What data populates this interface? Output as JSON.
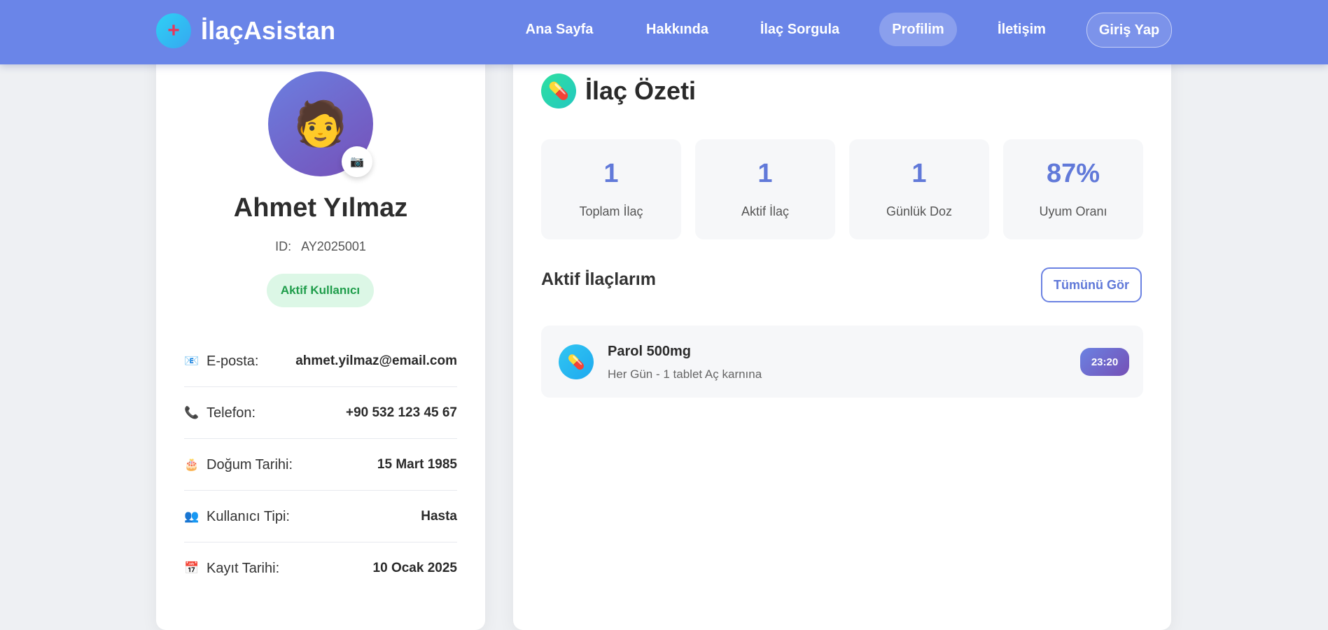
{
  "brand": {
    "name": "İlaçAsistan",
    "logo_symbol": "+",
    "icon": "plus-icon"
  },
  "nav": {
    "items": [
      {
        "label": "Ana Sayfa",
        "active": false
      },
      {
        "label": "Hakkında",
        "active": false
      },
      {
        "label": "İlaç Sorgula",
        "active": false
      },
      {
        "label": "Profilim",
        "active": true
      },
      {
        "label": "İletişim",
        "active": false
      }
    ],
    "login_label": "Giriş Yap"
  },
  "profile": {
    "avatar_icon": "🧑",
    "camera_icon": "📷",
    "name": "Ahmet Yılmaz",
    "id_label": "ID:",
    "id_value": "AY2025001",
    "status": "Aktif Kullanıcı",
    "info": [
      {
        "icon": "📧",
        "icon_name": "email-icon",
        "label": "E-posta:",
        "value": "ahmet.yilmaz@email.com"
      },
      {
        "icon": "📞",
        "icon_name": "phone-icon",
        "label": "Telefon:",
        "value": "+90 532 123 45 67"
      },
      {
        "icon": "🎂",
        "icon_name": "cake-icon",
        "label": "Doğum Tarihi:",
        "value": "15 Mart 1985"
      },
      {
        "icon": "👥",
        "icon_name": "users-icon",
        "label": "Kullanıcı Tipi:",
        "value": "Hasta"
      },
      {
        "icon": "📅",
        "icon_name": "calendar-icon",
        "label": "Kayıt Tarihi:",
        "value": "10 Ocak 2025"
      }
    ]
  },
  "summary": {
    "icon": "💊",
    "title": "İlaç Özeti",
    "stats": [
      {
        "value": "1",
        "label": "Toplam İlaç"
      },
      {
        "value": "1",
        "label": "Aktif İlaç"
      },
      {
        "value": "1",
        "label": "Günlük Doz"
      },
      {
        "value": "87%",
        "label": "Uyum Oranı"
      }
    ],
    "active_meds_title": "Aktif İlaçlarım",
    "see_all_label": "Tümünü Gör",
    "meds": [
      {
        "icon": "💊",
        "name": "Parol 500mg",
        "frequency": "Her Gün",
        "dose": "1 tablet",
        "note": "Aç karnına",
        "time": "23:20"
      }
    ]
  },
  "colors": {
    "navbar": "#6a85e8",
    "accent": "#6179d9",
    "status_green": "#1f9d4b",
    "time_badge_start": "#6b82e2",
    "time_badge_end": "#7550b6"
  }
}
